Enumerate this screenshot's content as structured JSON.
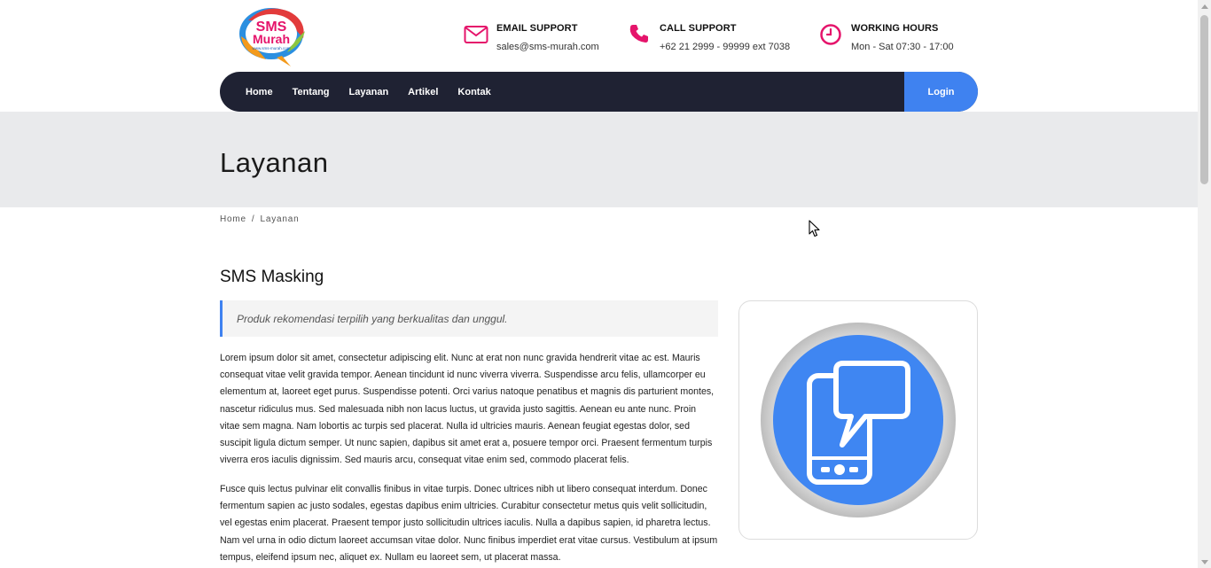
{
  "header": {
    "logo": {
      "line1": "SMS",
      "line2": "Murah",
      "tagline": "www.sms-murah.com"
    },
    "contacts": [
      {
        "icon": "envelope-icon",
        "title": "EMAIL SUPPORT",
        "value": "sales@sms-murah.com"
      },
      {
        "icon": "phone-icon",
        "title": "CALL SUPPORT",
        "value": "+62 21 2999 - 99999 ext 7038"
      },
      {
        "icon": "clock-icon",
        "title": "WORKING HOURS",
        "value": "Mon - Sat 07:30 - 17:00"
      }
    ]
  },
  "nav": {
    "items": [
      "Home",
      "Tentang",
      "Layanan",
      "Artikel",
      "Kontak"
    ],
    "login_label": "Login"
  },
  "banner": {
    "title": "Layanan"
  },
  "breadcrumb": {
    "home": "Home",
    "separator": "/",
    "current": "Layanan"
  },
  "content": {
    "title": "SMS Masking",
    "quote": "Produk rekomendasi terpilih yang berkualitas dan unggul.",
    "paragraph1": "Lorem ipsum dolor sit amet, consectetur adipiscing elit. Nunc at erat non nunc gravida hendrerit vitae ac est. Mauris consequat vitae velit gravida tempor. Aenean tincidunt id nunc viverra viverra. Suspendisse arcu felis, ullamcorper eu elementum at, laoreet eget purus. Suspendisse potenti. Orci varius natoque penatibus et magnis dis parturient montes, nascetur ridiculus mus. Sed malesuada nibh non lacus luctus, ut gravida justo sagittis. Aenean eu ante nunc. Proin vitae sem magna. Nam lobortis ac turpis sed placerat. Nulla id ultricies mauris. Aenean feugiat egestas dolor, sed suscipit ligula dictum semper. Ut nunc sapien, dapibus sit amet erat a, posuere tempor orci. Praesent fermentum turpis viverra eros iaculis dignissim. Sed mauris arcu, consequat vitae enim sed, commodo placerat felis.",
    "paragraph2": "Fusce quis lectus pulvinar elit convallis finibus in vitae turpis. Donec ultrices nibh ut libero consequat interdum. Donec fermentum sapien ac justo sodales, egestas dapibus enim ultricies. Curabitur consectetur metus quis velit sollicitudin, vel egestas enim placerat. Praesent tempor justo sollicitudin ultrices iaculis. Nulla a dapibus sapien, id pharetra lectus. Nam vel urna in odio dictum laoreet accumsan vitae dolor. Nunc finibus imperdiet erat vitae cursus. Vestibulum at ipsum tempus, eleifend ipsum nec, aliquet ex. Nullam eu laoreet sem, ut placerat massa."
  },
  "colors": {
    "accent": "#3f82f0",
    "navbar": "#1f2233",
    "icon_pink": "#e5146b",
    "banner_bg": "#e9eaec"
  }
}
